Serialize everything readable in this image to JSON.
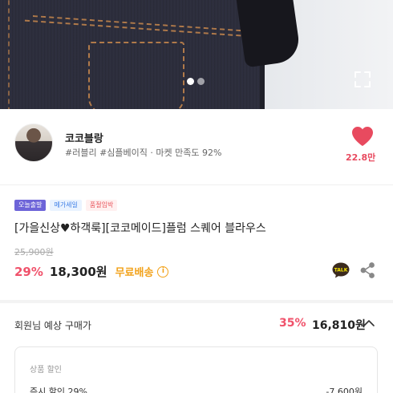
{
  "hero": {
    "image_alt": "product photo",
    "pagination": {
      "count": 2,
      "active": 0
    }
  },
  "seller": {
    "name": "코코블랑",
    "tags": "#러블리 #심플베이직 · 마켓 만족도 92%",
    "like_count": "22.8만"
  },
  "product": {
    "badges": [
      "오늘출발",
      "메가세일",
      "품절임박"
    ],
    "title": "[가을신상♥하객룩][코코메이드]플럼 스퀘어 블라우스",
    "original_price": "25,900원",
    "discount_rate": "29%",
    "price": "18,300원",
    "shipping": "무료배송",
    "info_mark": "i",
    "talk_label": "TALK"
  },
  "member_price": {
    "label": "회원님 예상 구매가",
    "discount_rate": "35%",
    "price": "16,810원"
  },
  "discount_detail": {
    "heading": "상품 할인",
    "rows": [
      {
        "label": "즉시 할인 29%",
        "amount": "-7,600원"
      }
    ]
  },
  "colors": {
    "accent_red": "#f0526b",
    "heart": "#e84a5f",
    "shipping": "#f2a21a",
    "badge_today": "#6d64d8",
    "badge_mega": "#3f7fe6",
    "badge_soldout": "#e8555c"
  },
  "icons": [
    "expand-icon",
    "heart-icon",
    "kakao-talk-icon",
    "share-icon",
    "chevron-up-icon",
    "info-icon"
  ]
}
